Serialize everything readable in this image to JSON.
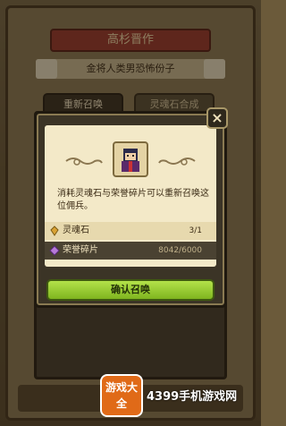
{
  "background": {
    "banner_title": "高杉晋作",
    "subtitle": "金将人类男恐怖份子"
  },
  "tabs": [
    {
      "label": "重新召唤",
      "active": true
    },
    {
      "label": "灵魂石合成",
      "active": false
    }
  ],
  "modal": {
    "close_label": "×",
    "description": "消耗灵魂石与荣誉碎片可以重新召唤这位佣兵。",
    "resources": [
      {
        "label": "灵魂石",
        "value": "3/1",
        "icon": "soul-stone-icon"
      },
      {
        "label": "荣誉碎片",
        "value": "8042/6000",
        "icon": "honor-shard-icon"
      }
    ],
    "confirm_label": "确认召唤"
  },
  "watermark": {
    "site_text": "4399手机游戏网",
    "badge_text": "游戏大全"
  },
  "colors": {
    "confirm_button": "#9ccb35",
    "parchment": "#f3e9c8",
    "modal_frame": "#3b3426"
  }
}
